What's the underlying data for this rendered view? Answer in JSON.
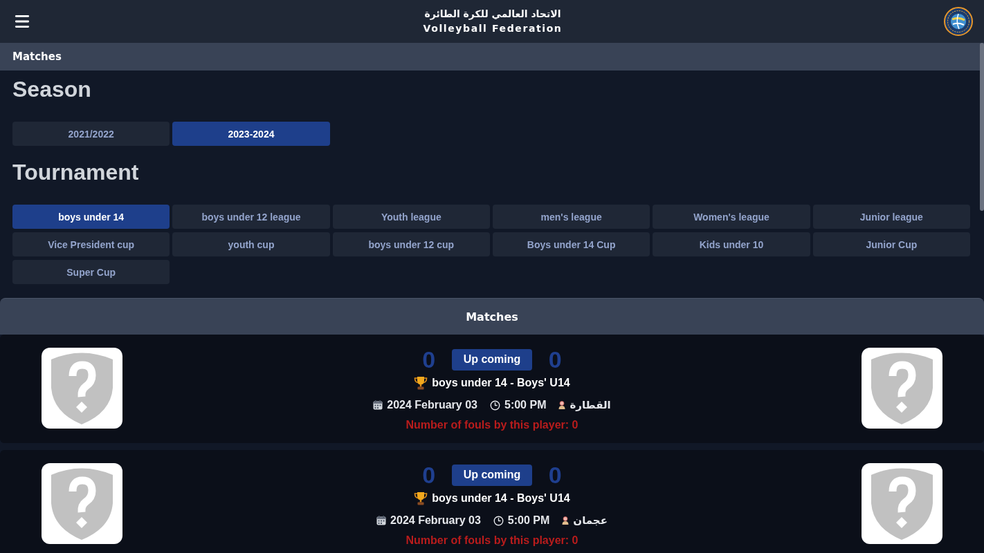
{
  "header": {
    "title_arabic": "الاتحاد العالمي للكرة الطائرة",
    "title": "Volleyball Federation"
  },
  "page_bar": {
    "title": "Matches"
  },
  "season": {
    "heading": "Season",
    "options": [
      {
        "label": "2021/2022",
        "selected": false
      },
      {
        "label": "2023-2024",
        "selected": true
      }
    ]
  },
  "tournament": {
    "heading": "Tournament",
    "options": [
      {
        "label": "boys under 14",
        "selected": true
      },
      {
        "label": "boys under 12 league",
        "selected": false
      },
      {
        "label": "Youth league",
        "selected": false
      },
      {
        "label": "men's league",
        "selected": false
      },
      {
        "label": "Women's league",
        "selected": false
      },
      {
        "label": "Junior league",
        "selected": false
      },
      {
        "label": "Vice President cup",
        "selected": false
      },
      {
        "label": "youth cup",
        "selected": false
      },
      {
        "label": "boys under 12 cup",
        "selected": false
      },
      {
        "label": "Boys under 14 Cup",
        "selected": false
      },
      {
        "label": "Kids under 10",
        "selected": false
      },
      {
        "label": "Junior Cup",
        "selected": false
      },
      {
        "label": "Super Cup",
        "selected": false
      }
    ]
  },
  "matches": {
    "heading": "Matches",
    "items": [
      {
        "home_score": "0",
        "status": "Up coming",
        "away_score": "0",
        "competition": "boys under 14 - Boys' U14",
        "date": "2024 February 03",
        "time": "5:00 PM",
        "venue": "القطارة",
        "fouls": "Number of fouls by this player: 0"
      },
      {
        "home_score": "0",
        "status": "Up coming",
        "away_score": "0",
        "competition": "boys under 14 - Boys' U14",
        "date": "2024 February 03",
        "time": "5:00 PM",
        "venue": "عجمان",
        "fouls": "Number of fouls by this player: 0"
      }
    ]
  }
}
